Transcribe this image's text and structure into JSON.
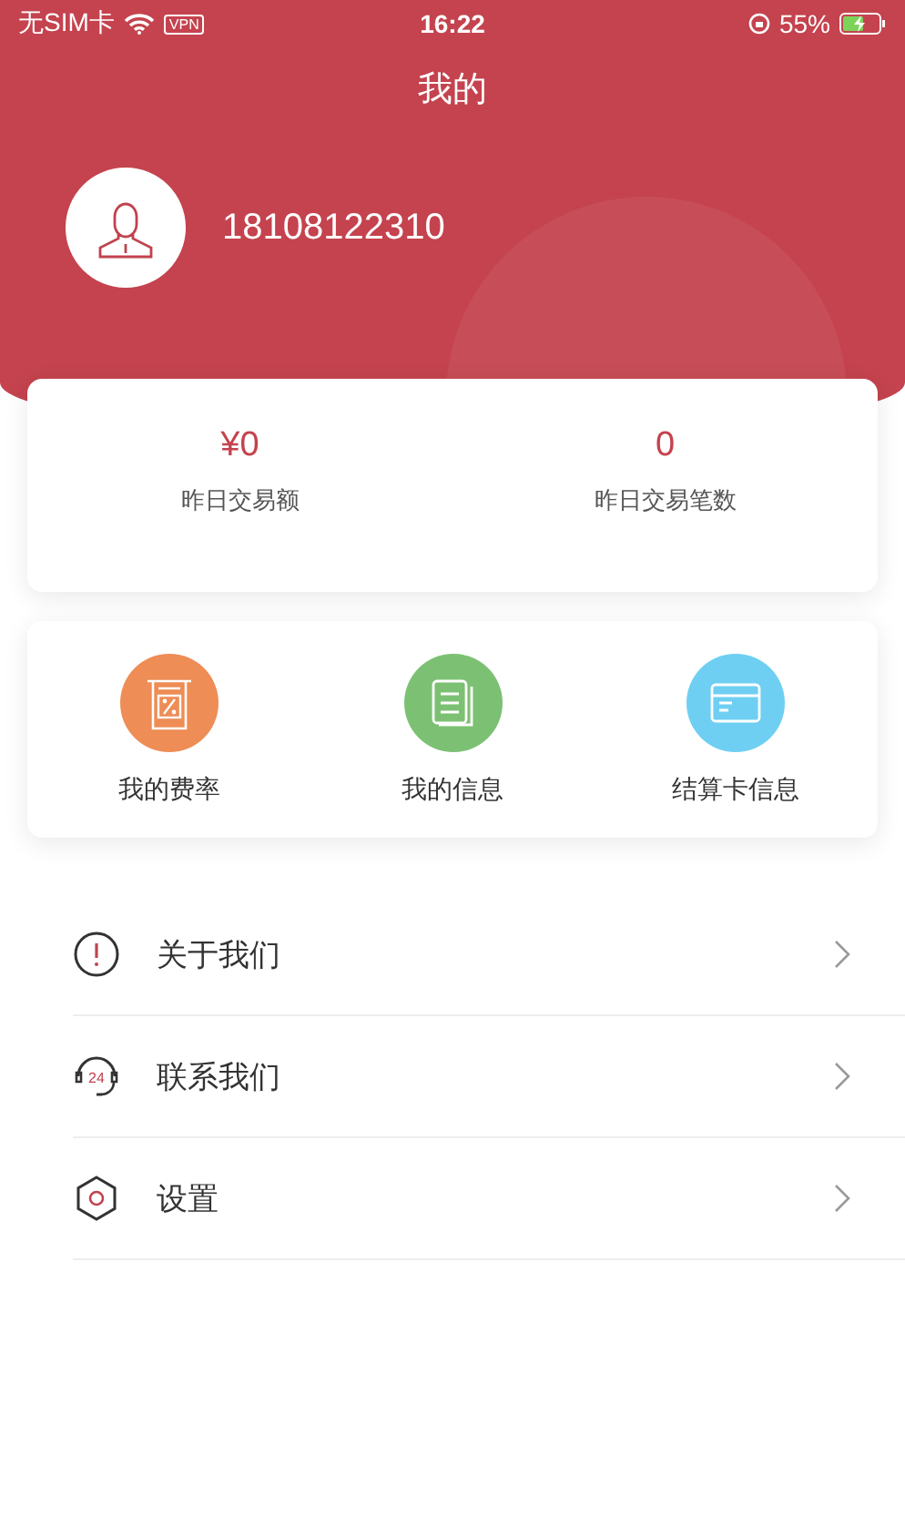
{
  "status_bar": {
    "carrier": "无SIM卡",
    "vpn": "VPN",
    "time": "16:22",
    "battery": "55%"
  },
  "header": {
    "title": "我的"
  },
  "profile": {
    "phone": "18108122310"
  },
  "stats": [
    {
      "value": "¥0",
      "label": "昨日交易额"
    },
    {
      "value": "0",
      "label": "昨日交易笔数"
    }
  ],
  "shortcuts": [
    {
      "kind": "rate",
      "label": "我的费率",
      "color": "#ee8d55"
    },
    {
      "kind": "info",
      "label": "我的信息",
      "color": "#7cc173"
    },
    {
      "kind": "card",
      "label": "结算卡信息",
      "color": "#6fcff2"
    }
  ],
  "menu": [
    {
      "kind": "about",
      "label": "关于我们"
    },
    {
      "kind": "contact",
      "label": "联系我们",
      "icon_text": "24"
    },
    {
      "kind": "settings",
      "label": "设置"
    }
  ]
}
